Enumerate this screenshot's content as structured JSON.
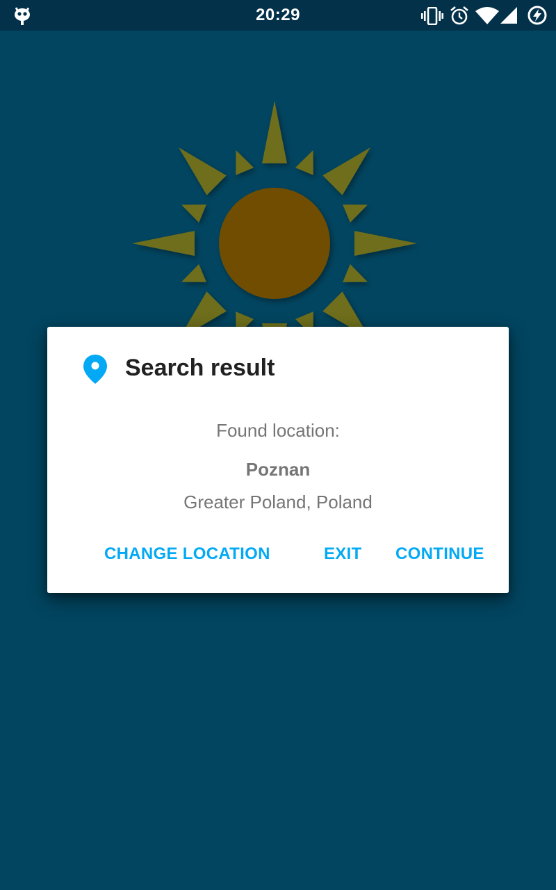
{
  "status_bar": {
    "time": "20:29",
    "icons": [
      "cyanogen-bugdroid-icon",
      "vibrate-icon",
      "alarm-icon",
      "wifi-icon",
      "cellular-signal-icon",
      "battery-charging-icon"
    ]
  },
  "background": {
    "logo": "sun-icon",
    "colors": {
      "background": "#024560",
      "status_bar": "#033149",
      "sun_rays": "#6e6e1c",
      "sun_core": "#6f4e00"
    }
  },
  "dialog": {
    "icon": "location-pin-icon",
    "title": "Search result",
    "found_label": "Found location:",
    "city": "Poznan",
    "region": "Greater Poland, Poland",
    "buttons": {
      "change_location": "CHANGE LOCATION",
      "exit": "EXIT",
      "continue": "CONTINUE"
    },
    "accent_color": "#03a9f4"
  }
}
